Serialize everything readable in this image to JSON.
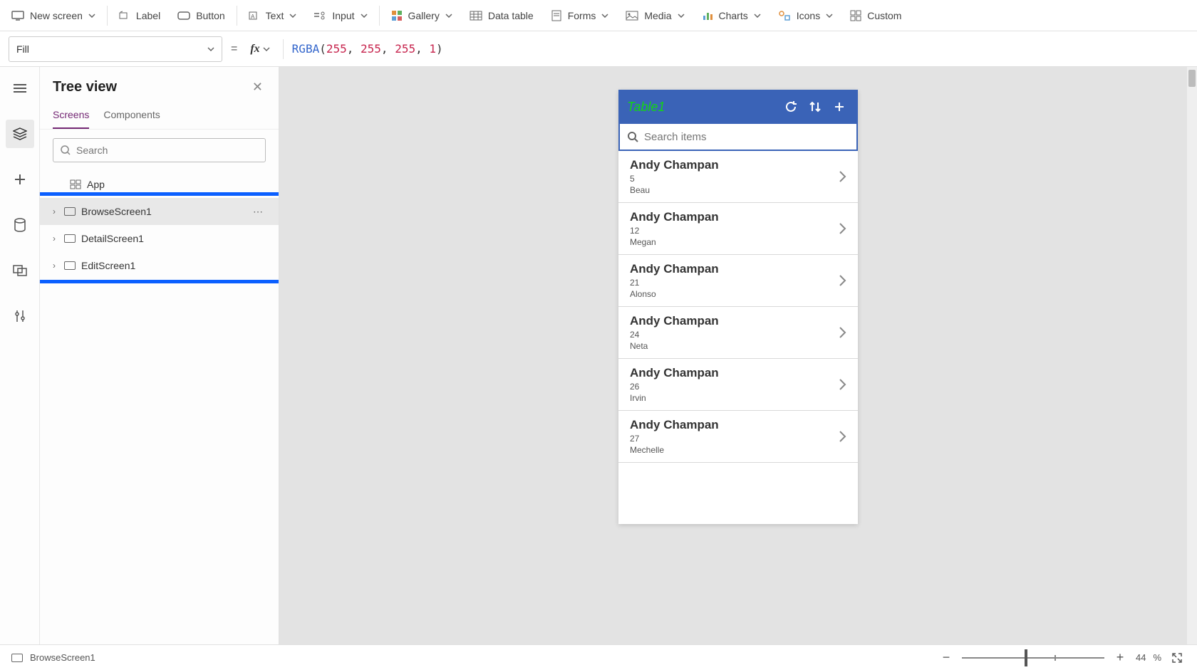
{
  "toolbar": {
    "new_screen": "New screen",
    "label": "Label",
    "button": "Button",
    "text": "Text",
    "input": "Input",
    "gallery": "Gallery",
    "data_table": "Data table",
    "forms": "Forms",
    "media": "Media",
    "charts": "Charts",
    "icons": "Icons",
    "custom": "Custom"
  },
  "formula": {
    "property": "Fill",
    "fn": "RGBA",
    "args": [
      "255",
      "255",
      "255",
      "1"
    ]
  },
  "tree": {
    "title": "Tree view",
    "tabs": {
      "screens": "Screens",
      "components": "Components"
    },
    "search_placeholder": "Search",
    "nodes": {
      "app": "App",
      "browse": "BrowseScreen1",
      "detail": "DetailScreen1",
      "edit": "EditScreen1"
    }
  },
  "phone": {
    "title": "Table1",
    "search_placeholder": "Search items",
    "items": [
      {
        "title": "Andy Champan",
        "subtitle": "5",
        "body": "Beau"
      },
      {
        "title": "Andy Champan",
        "subtitle": "12",
        "body": "Megan"
      },
      {
        "title": "Andy Champan",
        "subtitle": "21",
        "body": "Alonso"
      },
      {
        "title": "Andy Champan",
        "subtitle": "24",
        "body": "Neta"
      },
      {
        "title": "Andy Champan",
        "subtitle": "26",
        "body": "Irvin"
      },
      {
        "title": "Andy Champan",
        "subtitle": "27",
        "body": "Mechelle"
      }
    ]
  },
  "status": {
    "selected": "BrowseScreen1",
    "zoom": "44",
    "zoom_unit": "%"
  }
}
